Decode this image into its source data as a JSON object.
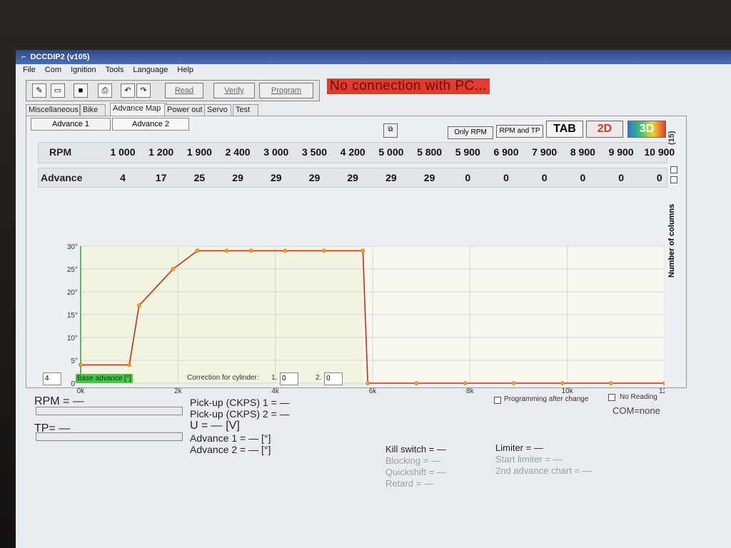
{
  "window": {
    "title": "DCCDIP2 (v105)"
  },
  "menu": [
    "File",
    "Com",
    "Ignition",
    "Tools",
    "Language",
    "Help"
  ],
  "toolbar": {
    "read_label": "Read",
    "verify_label": "Verify",
    "program_label": "Program"
  },
  "status": {
    "text": "No connection with PC..."
  },
  "tabs": [
    "Miscellaneous",
    "Bike",
    "Advance Map",
    "Power out",
    "Servo",
    "Test"
  ],
  "subtabs": [
    "Advance 1",
    "Advance 2"
  ],
  "view_buttons": {
    "only_rpm": "Only RPM",
    "rpm_and_tp": "RPM and TP",
    "tab": "TAB",
    "two_d": "2D",
    "three_d": "3D"
  },
  "table": {
    "rpm_label": "RPM",
    "advance_label": "Advance",
    "rpm": [
      "1 000",
      "1 200",
      "1 900",
      "2 400",
      "3 000",
      "3 500",
      "4 200",
      "5 000",
      "5 800",
      "5 900",
      "6 900",
      "7 900",
      "8 900",
      "9 900",
      "10 900"
    ],
    "advance": [
      "4",
      "17",
      "25",
      "29",
      "29",
      "29",
      "29",
      "29",
      "29",
      "0",
      "0",
      "0",
      "0",
      "0",
      "0"
    ]
  },
  "columns": {
    "count_label": "(15)",
    "label": "Number of columns"
  },
  "chart_data": {
    "type": "line",
    "x": [
      0,
      1000,
      1200,
      1900,
      2400,
      3000,
      3500,
      4200,
      5000,
      5800,
      5900,
      6900,
      7900,
      8900,
      9900,
      10900,
      12000
    ],
    "y": [
      4,
      4,
      17,
      25,
      29,
      29,
      29,
      29,
      29,
      29,
      0,
      0,
      0,
      0,
      0,
      0,
      0
    ],
    "xlim": [
      0,
      12000
    ],
    "ylim": [
      0,
      30
    ],
    "xticks": [
      "0k",
      "2k",
      "4k",
      "6k",
      "8k",
      "10k",
      "12k"
    ],
    "yticks": [
      "0°",
      "5°",
      "10°",
      "15°",
      "20°",
      "25°",
      "30°"
    ],
    "color": "#cc2a1c",
    "marker_color": "#e8a63a",
    "grid": true
  },
  "base_advance": {
    "value": "4",
    "label": "Base advance [°]"
  },
  "correction": {
    "label": "Correction for cylinder:",
    "cyl1_label": "1.",
    "cyl1_value": "0",
    "cyl2_label": "2.",
    "cyl2_value": "0"
  },
  "options": {
    "programming_after_change": "Programming after change",
    "no_reading": "No Reading",
    "com": "COM=none"
  },
  "readouts": {
    "rpm": "RPM = —",
    "tp": "TP= —",
    "pickup1": "Pick-up (CKPS) 1 = —",
    "pickup2": "Pick-up (CKPS) 2 = —",
    "voltage": "U = — [V]",
    "advance1": "Advance 1 = — [°]",
    "advance2": "Advance 2 = — [°]",
    "kill_switch": "Kill switch = —",
    "blocking": "Blocking = —",
    "quickshift": "Quickshift = —",
    "retard": "Retard = —",
    "limiter": "Limiter = —",
    "start_limiter": "Start limiter = —",
    "second_chart": "2nd advance chart = —"
  }
}
